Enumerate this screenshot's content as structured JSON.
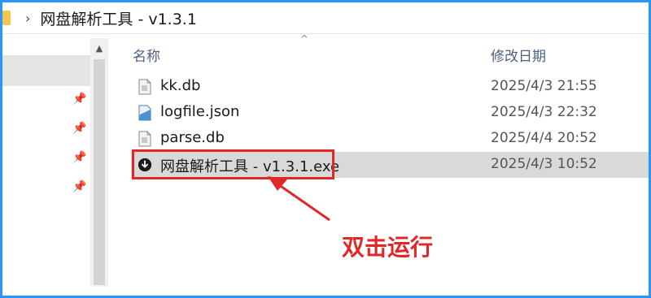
{
  "breadcrumb": {
    "chevron": "›",
    "path": "网盘解析工具 - v1.3.1"
  },
  "nav": {
    "pins": [
      "pin-icon",
      "pin-icon",
      "pin-icon",
      "pin-icon"
    ]
  },
  "columns": {
    "name": "名称",
    "modified": "修改日期"
  },
  "files": [
    {
      "name": "kk.db",
      "modified": "2025/4/3 21:55",
      "icon": "db-file-icon"
    },
    {
      "name": "logfile.json",
      "modified": "2025/4/3 22:32",
      "icon": "json-file-icon"
    },
    {
      "name": "parse.db",
      "modified": "2025/4/4 20:52",
      "icon": "db-file-icon"
    },
    {
      "name": "网盘解析工具 - v1.3.1.exe",
      "modified": "2025/4/3 10:52",
      "icon": "download-app-icon",
      "selected": true
    }
  ],
  "annotation": {
    "label": "双击运行",
    "color": "#e02828"
  },
  "colors": {
    "frame": "#2b95ff",
    "selected_row": "#d9d9d9",
    "header_text": "#4d6082"
  }
}
